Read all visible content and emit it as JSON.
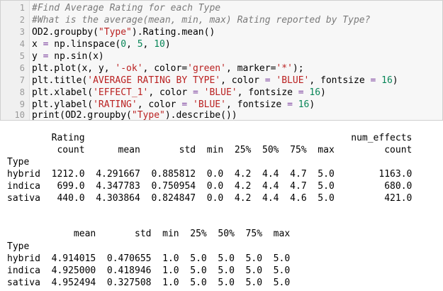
{
  "code": {
    "line_numbers": [
      "1",
      "2",
      "3",
      "4",
      "5",
      "6",
      "7",
      "8",
      "9",
      "10"
    ],
    "l1": "#Find Average Rating for each Type",
    "l2": "#What is the average(mean, min, max) Rating reported by Type?",
    "l3a": "OD2.groupby(",
    "l3s": "\"Type\"",
    "l3b": ").Rating.mean()",
    "l4a": "x ",
    "l4op": "=",
    "l4b": " np.linspace(",
    "l4n1": "0",
    "l4c": ", ",
    "l4n2": "5",
    "l4d": ", ",
    "l4n3": "10",
    "l4e": ")",
    "l5a": "y ",
    "l5op": "=",
    "l5b": " np.sin(x)",
    "l6a": "plt.plot(x, y, ",
    "l6s1": "'-ok'",
    "l6b": ", color=",
    "l6s2": "'green'",
    "l6c": ", marker=",
    "l6s3": "'*'",
    "l6d": ");",
    "l7a": "plt.title(",
    "l7s1": "'AVERAGE RATING BY TYPE'",
    "l7b": ", color ",
    "l7op1": "=",
    "l7c": " ",
    "l7s2": "'BLUE'",
    "l7d": ", fontsize ",
    "l7op2": "=",
    "l7e": " ",
    "l7n": "16",
    "l7f": ")",
    "l8a": "plt.xlabel(",
    "l8s1": "'EFFECT_1'",
    "l8b": ", color ",
    "l8op1": "=",
    "l8c": " ",
    "l8s2": "'BLUE'",
    "l8d": ", fontsize ",
    "l8op2": "=",
    "l8e": " ",
    "l8n": "16",
    "l8f": ")",
    "l9a": "plt.ylabel(",
    "l9s1": "'RATING'",
    "l9b": ", color ",
    "l9op1": "=",
    "l9c": " ",
    "l9s2": "'BLUE'",
    "l9d": ", fontsize ",
    "l9op2": "=",
    "l9e": " ",
    "l9n": "16",
    "l9f": ")",
    "l10a": "print(OD2.groupby(",
    "l10s": "\"Type\"",
    "l10b": ").describe())"
  },
  "output1": {
    "header1": "        Rating                                                num_effects",
    "header2": "         count      mean       std  min  25%  50%  75%  max         count",
    "index_label": "Type",
    "rows": [
      "hybrid  1212.0  4.291667  0.885812  0.0  4.2  4.4  4.7  5.0        1163.0",
      "indica   699.0  4.347783  0.750954  0.0  4.2  4.4  4.7  5.0         680.0",
      "sativa   440.0  4.303864  0.824847  0.0  4.2  4.4  4.6  5.0         421.0"
    ]
  },
  "output2": {
    "header": "            mean       std  min  25%  50%  75%  max",
    "index_label": "Type",
    "rows": [
      "hybrid  4.914015  0.470655  1.0  5.0  5.0  5.0  5.0",
      "indica  4.925000  0.418946  1.0  5.0  5.0  5.0  5.0",
      "sativa  4.952494  0.327508  1.0  5.0  5.0  5.0  5.0"
    ]
  }
}
